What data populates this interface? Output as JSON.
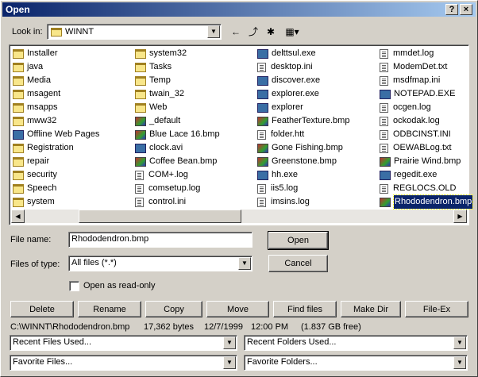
{
  "window": {
    "title": "Open",
    "help_glyph": "?",
    "close_glyph": "×"
  },
  "lookin": {
    "label": "Look in:",
    "value": "WINNT"
  },
  "toolbar": {
    "back": "←",
    "up": "⤴",
    "new_folder": "✱",
    "view_menu": "▦▾"
  },
  "columns": [
    [
      {
        "name": "Installer",
        "icon": "folder"
      },
      {
        "name": "java",
        "icon": "folder"
      },
      {
        "name": "Media",
        "icon": "folder"
      },
      {
        "name": "msagent",
        "icon": "folder"
      },
      {
        "name": "msapps",
        "icon": "folder"
      },
      {
        "name": "mww32",
        "icon": "folder"
      },
      {
        "name": "Offline Web Pages",
        "icon": "exe"
      },
      {
        "name": "Registration",
        "icon": "folder"
      },
      {
        "name": "repair",
        "icon": "folder"
      },
      {
        "name": "security",
        "icon": "folder"
      },
      {
        "name": "Speech",
        "icon": "folder"
      },
      {
        "name": "system",
        "icon": "folder"
      }
    ],
    [
      {
        "name": "system32",
        "icon": "folder"
      },
      {
        "name": "Tasks",
        "icon": "folder"
      },
      {
        "name": "Temp",
        "icon": "folder"
      },
      {
        "name": "twain_32",
        "icon": "folder"
      },
      {
        "name": "Web",
        "icon": "folder"
      },
      {
        "name": "_default",
        "icon": "img"
      },
      {
        "name": "Blue Lace 16.bmp",
        "icon": "img"
      },
      {
        "name": "clock.avi",
        "icon": "exe"
      },
      {
        "name": "Coffee Bean.bmp",
        "icon": "img"
      },
      {
        "name": "COM+.log",
        "icon": "file"
      },
      {
        "name": "comsetup.log",
        "icon": "file"
      },
      {
        "name": "control.ini",
        "icon": "file"
      }
    ],
    [
      {
        "name": "delttsul.exe",
        "icon": "exe"
      },
      {
        "name": "desktop.ini",
        "icon": "file"
      },
      {
        "name": "discover.exe",
        "icon": "exe"
      },
      {
        "name": "explorer.exe",
        "icon": "exe"
      },
      {
        "name": "explorer",
        "icon": "exe"
      },
      {
        "name": "FeatherTexture.bmp",
        "icon": "img"
      },
      {
        "name": "folder.htt",
        "icon": "file"
      },
      {
        "name": "Gone Fishing.bmp",
        "icon": "img"
      },
      {
        "name": "Greenstone.bmp",
        "icon": "img"
      },
      {
        "name": "hh.exe",
        "icon": "exe"
      },
      {
        "name": "iis5.log",
        "icon": "file"
      },
      {
        "name": "imsins.log",
        "icon": "file"
      }
    ],
    [
      {
        "name": "mmdet.log",
        "icon": "file"
      },
      {
        "name": "ModemDet.txt",
        "icon": "file"
      },
      {
        "name": "msdfmap.ini",
        "icon": "file"
      },
      {
        "name": "NOTEPAD.EXE",
        "icon": "exe"
      },
      {
        "name": "ocgen.log",
        "icon": "file"
      },
      {
        "name": "ockodak.log",
        "icon": "file"
      },
      {
        "name": "ODBCINST.INI",
        "icon": "file"
      },
      {
        "name": "OEWABLog.txt",
        "icon": "file"
      },
      {
        "name": "Prairie Wind.bmp",
        "icon": "img"
      },
      {
        "name": "regedit.exe",
        "icon": "exe"
      },
      {
        "name": "REGLOCS.OLD",
        "icon": "file"
      },
      {
        "name": "Rhododendron.bmp",
        "icon": "img",
        "selected": true
      }
    ]
  ],
  "filename": {
    "label": "File name:",
    "value": "Rhododendron.bmp"
  },
  "filetype": {
    "label": "Files of type:",
    "value": "All files (*.*)"
  },
  "readonly": {
    "label": "Open as read-only"
  },
  "buttons": {
    "open": "Open",
    "cancel": "Cancel"
  },
  "actions": [
    "Delete",
    "Rename",
    "Copy",
    "Move",
    "Find files",
    "Make Dir",
    "File-Ex"
  ],
  "status": {
    "path": "C:\\WINNT\\Rhododendron.bmp",
    "size": "17,362 bytes",
    "date": "12/7/1999",
    "time": "12:00 PM",
    "free": "(1.837 GB free)"
  },
  "recent": {
    "files": "Recent Files Used...",
    "folders": "Recent Folders Used..."
  },
  "favorites": {
    "files": "Favorite Files...",
    "folders": "Favorite Folders..."
  },
  "glyphs": {
    "down": "▼",
    "left": "◀",
    "right": "▶"
  }
}
